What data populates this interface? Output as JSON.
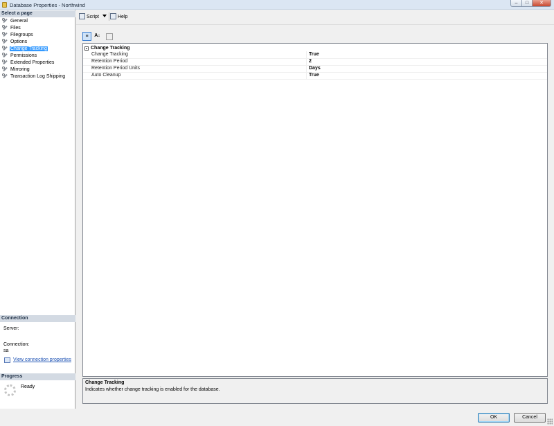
{
  "window": {
    "title": "Database Properties - Northwind",
    "minimize": "–",
    "maximize": "□",
    "close": "✕"
  },
  "left_panel": {
    "select_page_header": "Select a page",
    "pages": [
      {
        "label": "General"
      },
      {
        "label": "Files"
      },
      {
        "label": "Filegroups"
      },
      {
        "label": "Options"
      },
      {
        "label": "Change Tracking",
        "selected": true
      },
      {
        "label": "Permissions"
      },
      {
        "label": "Extended Properties"
      },
      {
        "label": "Mirroring"
      },
      {
        "label": "Transaction Log Shipping"
      }
    ],
    "connection_header": "Connection",
    "server_label": "Server:",
    "connection_label": "Connection:",
    "connection_value": "sa",
    "view_connection_link": "View connection properties",
    "progress_header": "Progress",
    "progress_status": "Ready"
  },
  "toolbar": {
    "script_label": "Script",
    "help_label": "Help"
  },
  "grid": {
    "category": "Change Tracking",
    "properties": [
      {
        "name": "Change Tracking",
        "value": "True"
      },
      {
        "name": "Retention Period",
        "value": "2"
      },
      {
        "name": "Retention Period Units",
        "value": "Days"
      },
      {
        "name": "Auto Cleanup",
        "value": "True"
      }
    ],
    "sort_alpha_icon": "A↓"
  },
  "description": {
    "title": "Change Tracking",
    "text": "Indicates whether change tracking is enabled for the database."
  },
  "buttons": {
    "ok": "OK",
    "cancel": "Cancel"
  }
}
